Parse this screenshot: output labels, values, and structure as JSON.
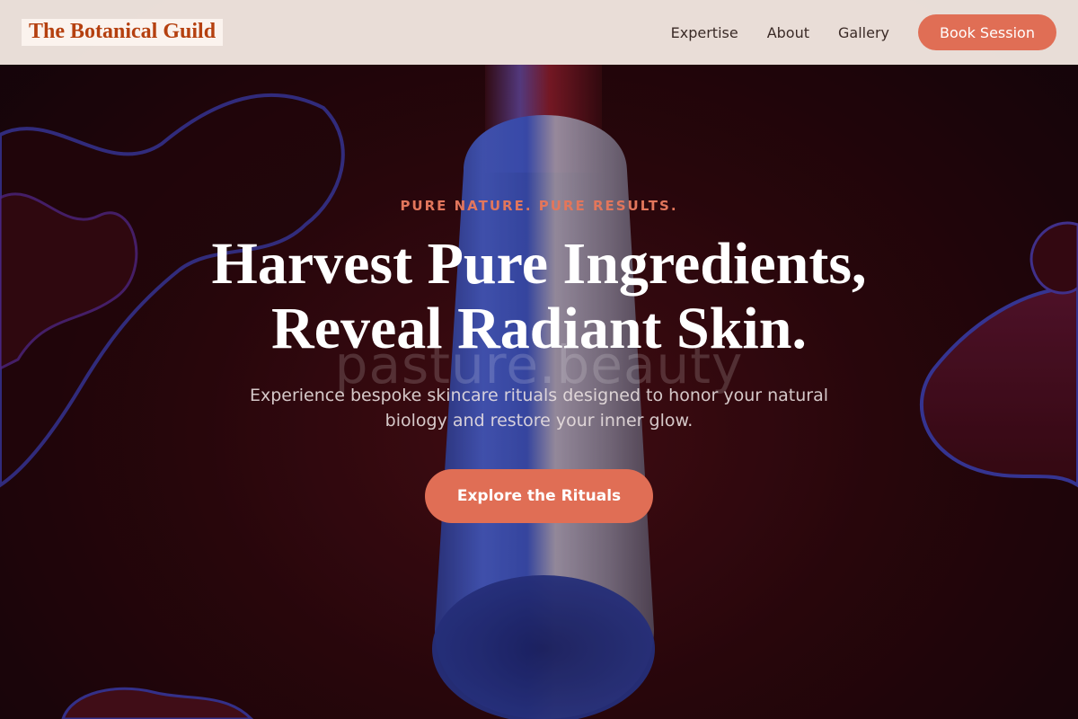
{
  "brand": {
    "name": "The Botanical Guild"
  },
  "nav": {
    "links": [
      "Expertise",
      "About",
      "Gallery"
    ],
    "cta_label": "Book Session"
  },
  "hero": {
    "eyebrow": "PURE NATURE. PURE RESULTS.",
    "headline_line1": "Harvest Pure Ingredients,",
    "headline_line2": "Reveal Radiant Skin.",
    "subtitle": "Experience bespoke skincare rituals designed to honor your natural biology and restore your inner glow.",
    "watermark": "pasture.beauty",
    "cta_label": "Explore the Rituals"
  },
  "colors": {
    "accent": "#e06e55",
    "brand_text": "#b5400f",
    "nav_background": "#f1e6e0",
    "hero_background": "#2c070d",
    "bottle_blue": "#3b57c9"
  }
}
